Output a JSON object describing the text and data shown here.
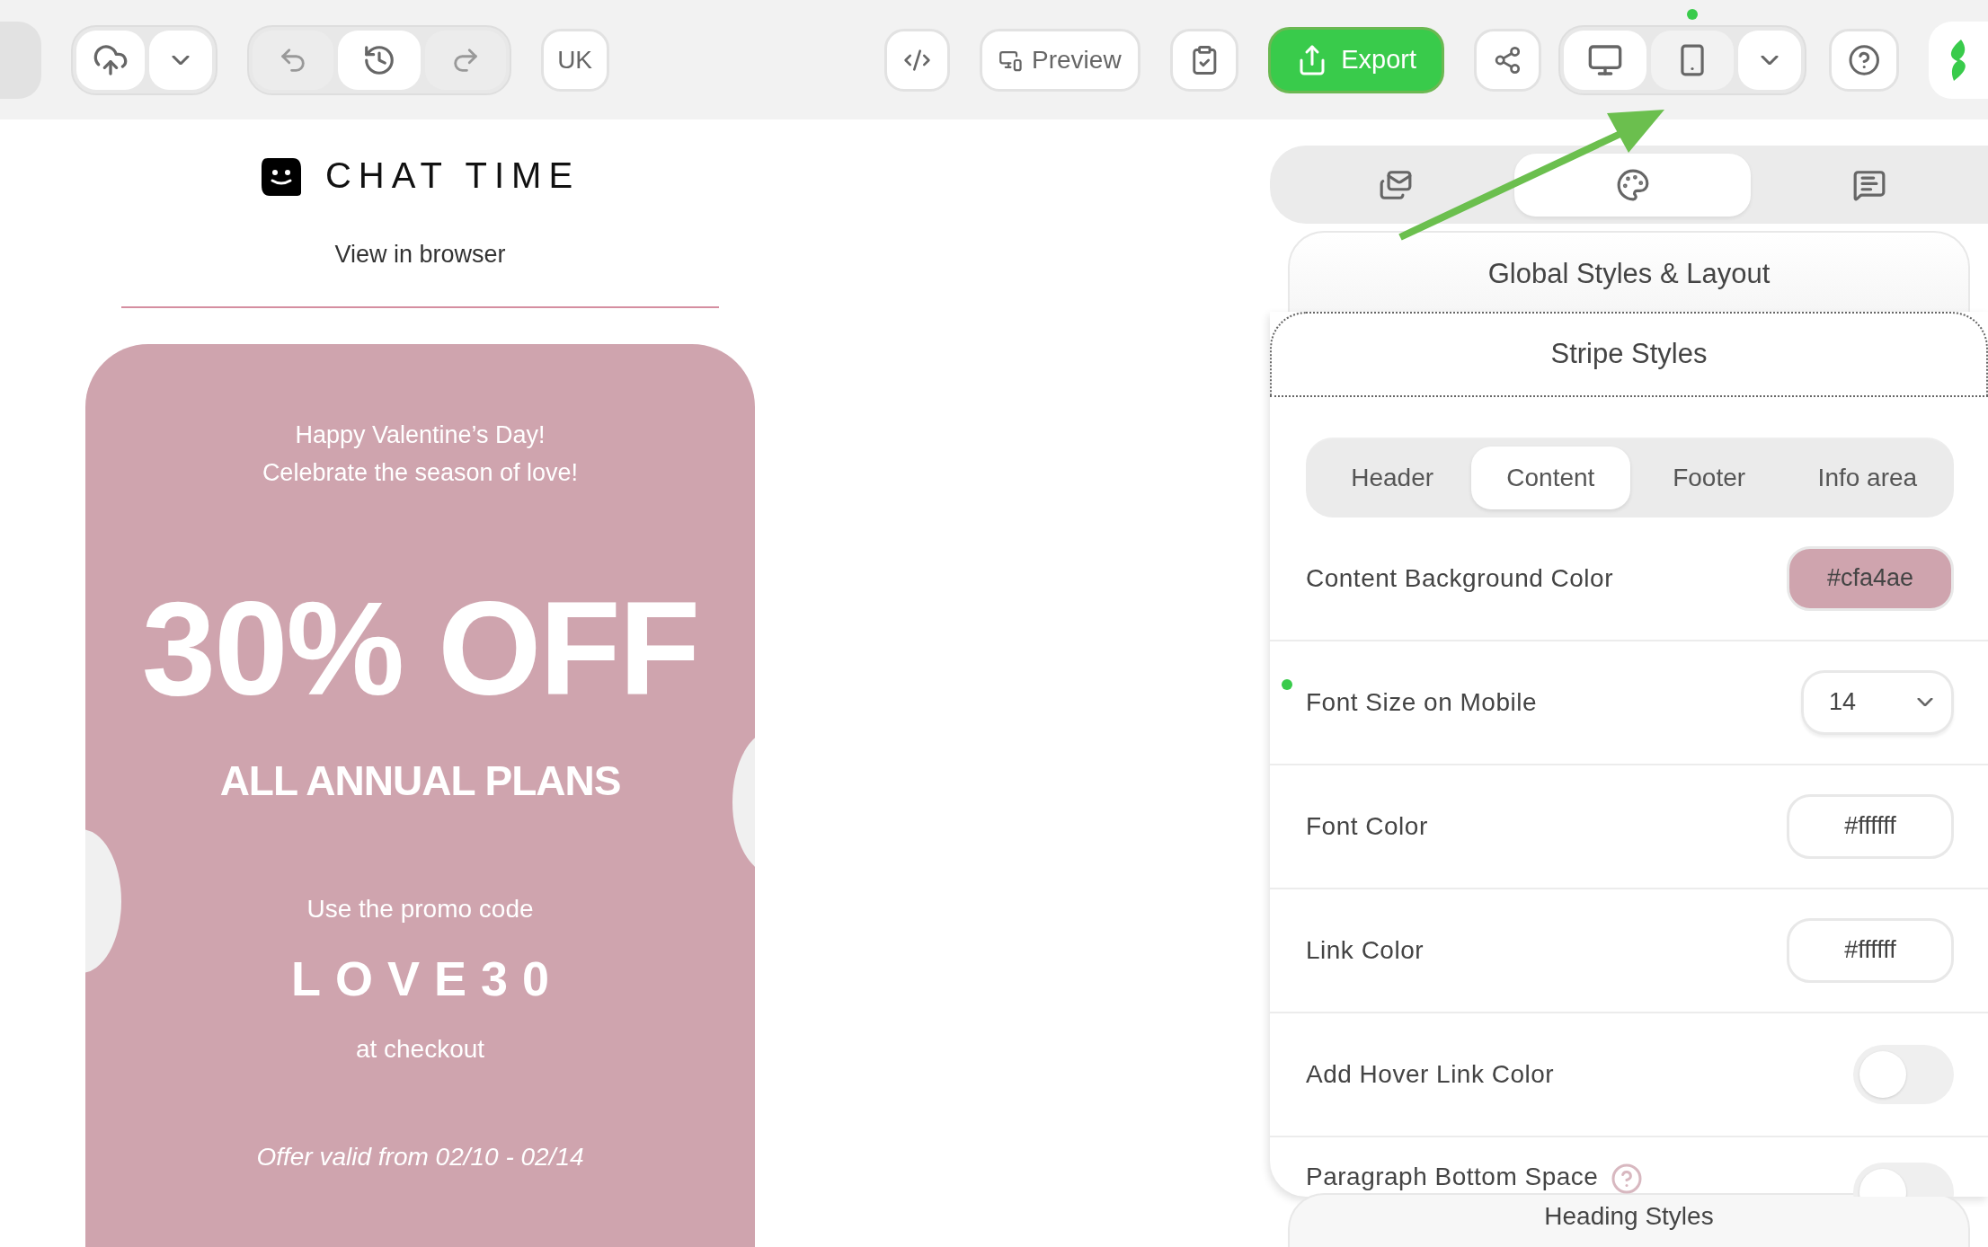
{
  "toolbar": {
    "save_actions": [
      {
        "kind": "upload"
      },
      {
        "kind": "caret"
      }
    ],
    "history_actions": [
      {
        "kind": "undo",
        "disabled": true
      },
      {
        "kind": "history",
        "disabled": false
      },
      {
        "kind": "redo",
        "disabled": true
      }
    ],
    "language": "UK",
    "preview": "Preview",
    "export": "Export",
    "devices": [
      {
        "kind": "desktop",
        "selected": false
      },
      {
        "kind": "mobile",
        "selected": true
      }
    ]
  },
  "email": {
    "brand": "CHAT TIME",
    "view_in_browser": "View in browser",
    "greeting": [
      "Happy Valentine’s Day!",
      "Celebrate the season of love!"
    ],
    "headline": "30% OFF",
    "subheadline": "ALL ANNUAL PLANS",
    "promo_intro": "Use the promo code",
    "promo_code": "LOVE30",
    "promo_outro": "at checkout",
    "validity": "Offer valid from 02/10 - 02/14"
  },
  "panel": {
    "tabs": [
      {
        "kind": "layout",
        "selected": false
      },
      {
        "kind": "styles",
        "selected": true
      },
      {
        "kind": "comments",
        "selected": false
      }
    ],
    "global_section": "Global Styles & Layout",
    "stripe_section": "Stripe Styles",
    "segments": [
      {
        "label": "Header",
        "selected": false
      },
      {
        "label": "Content",
        "selected": true
      },
      {
        "label": "Footer",
        "selected": false
      },
      {
        "label": "Info area",
        "selected": false
      }
    ],
    "settings": [
      {
        "kind": "color",
        "label": "Content Background Color",
        "value": "#cfa4ae",
        "color": "#cfa4ae",
        "modified": false
      },
      {
        "kind": "select",
        "label": "Font Size on Mobile",
        "value": "14",
        "modified": true
      },
      {
        "kind": "color",
        "label": "Font Color",
        "value": "#ffffff",
        "color": "#ffffff",
        "modified": false
      },
      {
        "kind": "color",
        "label": "Link Color",
        "value": "#ffffff",
        "color": "#ffffff",
        "modified": false
      },
      {
        "kind": "toggle",
        "label": "Add Hover Link Color",
        "on": false,
        "modified": false
      },
      {
        "kind": "toggle",
        "label": "Paragraph Bottom Space",
        "on": false,
        "help": true,
        "modified": false
      }
    ],
    "next_section": "Heading Styles"
  }
}
